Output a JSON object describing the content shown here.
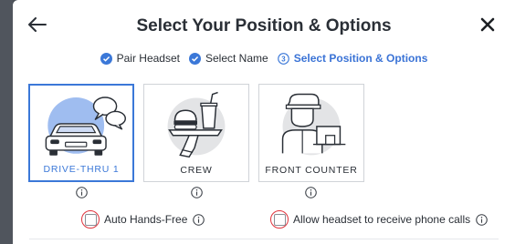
{
  "dialog": {
    "title": "Select Your Position & Options"
  },
  "steps": [
    {
      "label": "Pair Headset",
      "state": "done"
    },
    {
      "label": "Select Name",
      "state": "done"
    },
    {
      "label": "Select Position & Options",
      "state": "active",
      "number": "3"
    }
  ],
  "positions": [
    {
      "label": "DRIVE-THRU 1",
      "icon": "car-speech-icon",
      "selected": true
    },
    {
      "label": "CREW",
      "icon": "burger-tray-icon",
      "selected": false
    },
    {
      "label": "FRONT COUNTER",
      "icon": "cashier-icon",
      "selected": false
    }
  ],
  "options": {
    "auto_hands_free": {
      "label": "Auto Hands-Free",
      "checked": false
    },
    "phone_calls": {
      "label": "Allow headset to receive phone calls",
      "checked": false
    }
  },
  "colors": {
    "accent": "#3b78d8",
    "highlight": "#e0323b",
    "text": "#2a2f36"
  }
}
